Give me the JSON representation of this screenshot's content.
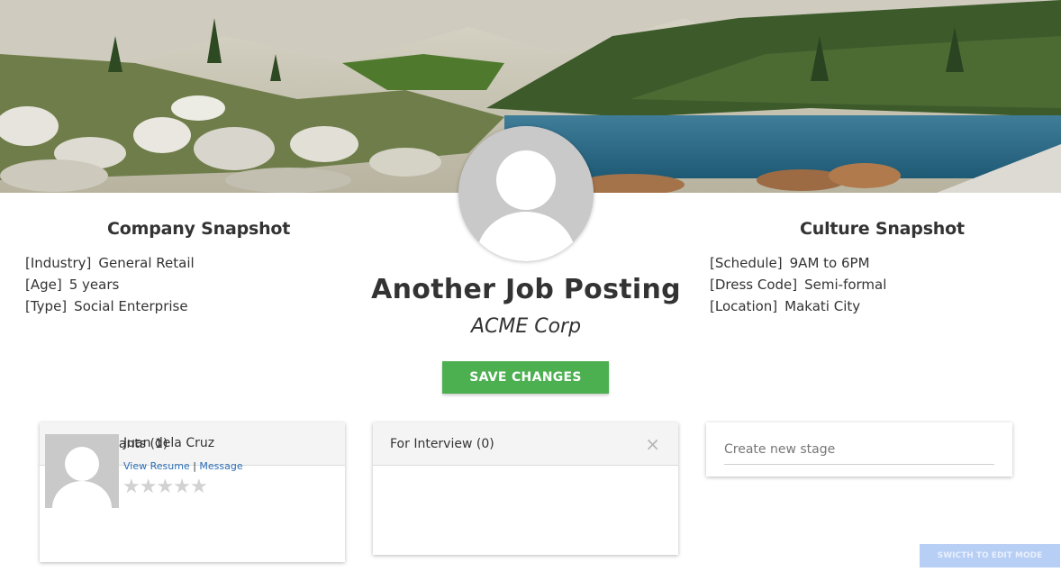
{
  "banner": {
    "image": "mountain-lake-landscape"
  },
  "profile": {
    "avatar": "default-person-avatar"
  },
  "company_snapshot": {
    "title": "Company Snapshot",
    "items": [
      {
        "label": "[Industry]",
        "value": "General Retail"
      },
      {
        "label": "[Age]",
        "value": "5 years"
      },
      {
        "label": "[Type]",
        "value": "Social Enterprise"
      }
    ]
  },
  "culture_snapshot": {
    "title": "Culture Snapshot",
    "items": [
      {
        "label": "[Schedule]",
        "value": "9AM to 6PM"
      },
      {
        "label": "[Dress Code]",
        "value": "Semi-formal"
      },
      {
        "label": "[Location]",
        "value": "Makati City"
      }
    ]
  },
  "job": {
    "title": "Another Job Posting",
    "company": "ACME Corp"
  },
  "actions": {
    "save_label": "SAVE CHANGES",
    "switch_label": "SWICTH TO EDIT MODE"
  },
  "stages": [
    {
      "title": "Job Applicants (1)",
      "applicants": [
        {
          "name": "Juan dela Cruz",
          "view_resume": "View Resume",
          "separator": "|",
          "message": "Message",
          "rating": 0,
          "rating_max": 5
        }
      ]
    },
    {
      "title": "For Interview (0)",
      "close_icon": "close-icon",
      "close_glyph": "×"
    }
  ],
  "new_stage": {
    "placeholder": "Create new stage"
  },
  "colors": {
    "accent_green": "#4caf50",
    "link_blue": "#2a6db5",
    "switch_bg": "#b7cef5"
  }
}
